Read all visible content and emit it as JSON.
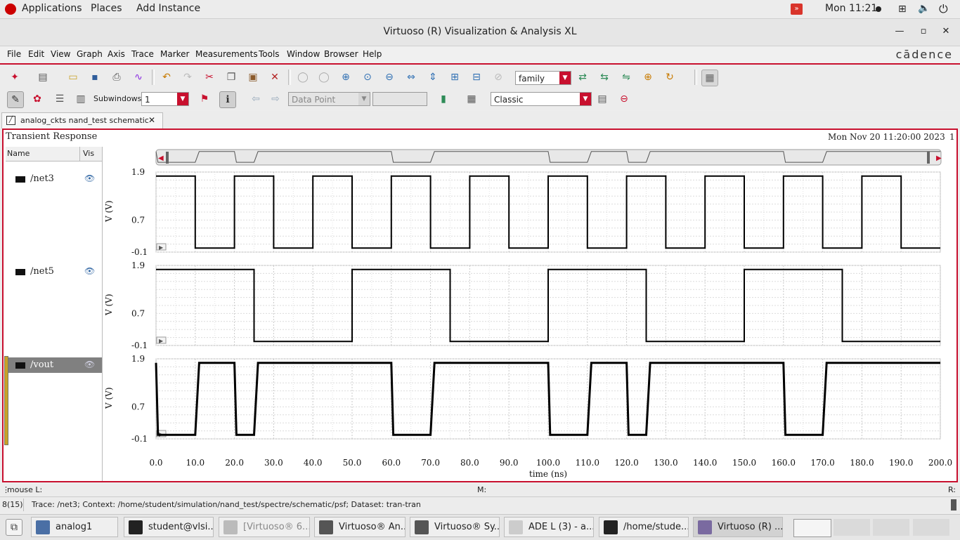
{
  "topbar": {
    "applications": "Applications",
    "places": "Places",
    "add_instance": "Add Instance",
    "clock": "Mon 11:21"
  },
  "window": {
    "title": "Virtuoso (R) Visualization & Analysis XL"
  },
  "menubar": {
    "items": [
      "File",
      "Edit",
      "View",
      "Graph",
      "Axis",
      "Trace",
      "Marker",
      "Measurements",
      "Tools",
      "Window",
      "Browser",
      "Help"
    ],
    "brand": "cādence"
  },
  "toolbar1": {
    "family_combo": "family"
  },
  "toolbar2": {
    "subwindows_label": "Subwindows:",
    "subwindows_value": "1",
    "datapoint_combo": "Data Point",
    "style_combo": "Classic"
  },
  "tab": {
    "label": "analog_ckts nand_test schematic"
  },
  "plot": {
    "title": "Transient Response",
    "timestamp": "Mon Nov 20 11:20:00 2023",
    "page_number": "1",
    "tree_header_name": "Name",
    "tree_header_vis": "Vis",
    "xlabel": "time (ns)"
  },
  "signals": [
    {
      "name": "/net3"
    },
    {
      "name": "/net5"
    },
    {
      "name": "/vout"
    }
  ],
  "chart_data": {
    "type": "line",
    "title": "Transient Response",
    "xlabel": "time (ns)",
    "ylabel": "V (V)",
    "xlim": [
      0,
      200
    ],
    "ylim": [
      -0.1,
      1.9
    ],
    "xticks": [
      "0.0",
      "10.0",
      "20.0",
      "30.0",
      "40.0",
      "50.0",
      "60.0",
      "70.0",
      "80.0",
      "90.0",
      "100.0",
      "110.0",
      "120.0",
      "130.0",
      "140.0",
      "150.0",
      "160.0",
      "170.0",
      "180.0",
      "190.0",
      "200.0"
    ],
    "yticks": [
      "1.9",
      "0.7",
      "-0.1"
    ],
    "grid": true,
    "series": [
      {
        "name": "/net3",
        "x": [
          0,
          10,
          10,
          20,
          20,
          30,
          30,
          40,
          40,
          50,
          50,
          60,
          60,
          70,
          70,
          80,
          80,
          90,
          90,
          100,
          100,
          110,
          110,
          120,
          120,
          130,
          130,
          140,
          140,
          150,
          150,
          160,
          160,
          170,
          170,
          180,
          180,
          190,
          190,
          200
        ],
        "y": [
          1.8,
          1.8,
          0,
          0,
          1.8,
          1.8,
          0,
          0,
          1.8,
          1.8,
          0,
          0,
          1.8,
          1.8,
          0,
          0,
          1.8,
          1.8,
          0,
          0,
          1.8,
          1.8,
          0,
          0,
          1.8,
          1.8,
          0,
          0,
          1.8,
          1.8,
          0,
          0,
          1.8,
          1.8,
          0,
          0,
          1.8,
          1.8,
          0,
          0
        ]
      },
      {
        "name": "/net5",
        "x": [
          0,
          25,
          25,
          50,
          50,
          75,
          75,
          100,
          100,
          125,
          125,
          150,
          150,
          175,
          175,
          200
        ],
        "y": [
          1.8,
          1.8,
          0,
          0,
          1.8,
          1.8,
          0,
          0,
          1.8,
          1.8,
          0,
          0,
          1.8,
          1.8,
          0,
          0
        ]
      },
      {
        "name": "/vout",
        "x": [
          0,
          0.5,
          10,
          11,
          20,
          20.5,
          25,
          26,
          60,
          60.5,
          70,
          71,
          100,
          100.5,
          110,
          111,
          120,
          120.5,
          125,
          126,
          160,
          160.5,
          170,
          171,
          200
        ],
        "y": [
          1.8,
          0,
          0,
          1.8,
          1.8,
          0,
          0,
          1.8,
          1.8,
          0,
          0,
          1.8,
          1.8,
          0,
          0,
          1.8,
          1.8,
          0,
          0,
          1.8,
          1.8,
          0,
          0,
          1.8,
          1.8
        ]
      }
    ]
  },
  "status": {
    "mouse_left": "mouse L:",
    "mouse_mid": "M:",
    "mouse_right": "R:",
    "counter": "8(15)",
    "trace_info": "Trace: /net3; Context: /home/student/simulation/nand_test/spectre/schematic/psf; Dataset: tran-tran"
  },
  "taskbar": {
    "items": [
      {
        "label": "analog1"
      },
      {
        "label": "student@vlsi..."
      },
      {
        "label": "[Virtuoso® 6...."
      },
      {
        "label": "Virtuoso® An..."
      },
      {
        "label": "Virtuoso® Sy..."
      },
      {
        "label": "ADE L (3) - a..."
      },
      {
        "label": "/home/stude..."
      },
      {
        "label": "Virtuoso (R) ..."
      }
    ]
  },
  "colors": {
    "accent": "#c8102e",
    "trace": "#000000",
    "selection": "#808080"
  }
}
